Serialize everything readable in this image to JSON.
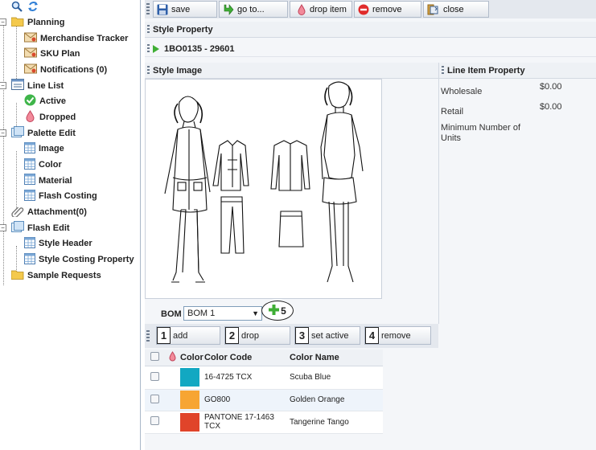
{
  "sidebar": {
    "items": [
      {
        "label": "Planning",
        "icon": "folder-icon",
        "level": 0,
        "expander": "-"
      },
      {
        "label": "Merchandise Tracker",
        "icon": "tracker-icon",
        "level": 1
      },
      {
        "label": "SKU Plan",
        "icon": "tracker-icon",
        "level": 1
      },
      {
        "label": "Notifications (0)",
        "icon": "tracker-icon",
        "level": 1
      },
      {
        "label": "Line List",
        "icon": "list-icon",
        "level": 0,
        "expander": "-"
      },
      {
        "label": "Active",
        "icon": "check-circle-icon",
        "level": 1
      },
      {
        "label": "Dropped",
        "icon": "drop-icon",
        "level": 1
      },
      {
        "label": "Palette Edit",
        "icon": "palette-icon",
        "level": 0,
        "expander": "-"
      },
      {
        "label": "Image",
        "icon": "grid-icon",
        "level": 1
      },
      {
        "label": "Color",
        "icon": "grid-icon",
        "level": 1
      },
      {
        "label": "Material",
        "icon": "grid-icon",
        "level": 1
      },
      {
        "label": "Flash Costing",
        "icon": "grid-icon",
        "level": 1
      },
      {
        "label": "Attachment(0)",
        "icon": "paperclip-icon",
        "level": 0
      },
      {
        "label": "Flash Edit",
        "icon": "palette-icon",
        "level": 0,
        "expander": "-"
      },
      {
        "label": "Style Header",
        "icon": "grid-icon",
        "level": 1
      },
      {
        "label": "Style Costing Property",
        "icon": "grid-icon",
        "level": 1
      },
      {
        "label": "Sample Requests",
        "icon": "folder-icon",
        "level": 0
      }
    ]
  },
  "toolbar": {
    "buttons": [
      {
        "label": "save",
        "icon": "save-icon"
      },
      {
        "label": "go to...",
        "icon": "goto-icon"
      },
      {
        "label": "drop item",
        "icon": "drop-icon"
      },
      {
        "label": "remove",
        "icon": "remove-icon"
      },
      {
        "label": "close",
        "icon": "close-icon"
      }
    ]
  },
  "style_property": {
    "title": "Style Property",
    "style_id": "1BO0135 - 29601"
  },
  "style_image": {
    "title": "Style Image"
  },
  "line_item": {
    "title": "Line Item Property",
    "fields": [
      {
        "label": "Wholesale",
        "value": "$0.00"
      },
      {
        "label": "Retail",
        "value": "$0.00"
      },
      {
        "label": "Minimum Number of Units",
        "value": ""
      }
    ]
  },
  "bom": {
    "label": "BOM",
    "selected": "BOM 1",
    "add_badge": "5",
    "buttons": [
      {
        "num": "1",
        "label": "add"
      },
      {
        "num": "2",
        "label": "drop"
      },
      {
        "num": "3",
        "label": "set active"
      },
      {
        "num": "4",
        "label": "remove"
      }
    ]
  },
  "color_table": {
    "headers": [
      "Color",
      "Color Code",
      "Color Name"
    ],
    "rows": [
      {
        "swatch": "#12a8c2",
        "code": "16-4725 TCX",
        "name": "Scuba Blue"
      },
      {
        "swatch": "#f7a533",
        "code": "GO800",
        "name": "Golden Orange"
      },
      {
        "swatch": "#e0442a",
        "code": "PANTONE 17-1463 TCX",
        "name": "Tangerine Tango"
      }
    ]
  }
}
